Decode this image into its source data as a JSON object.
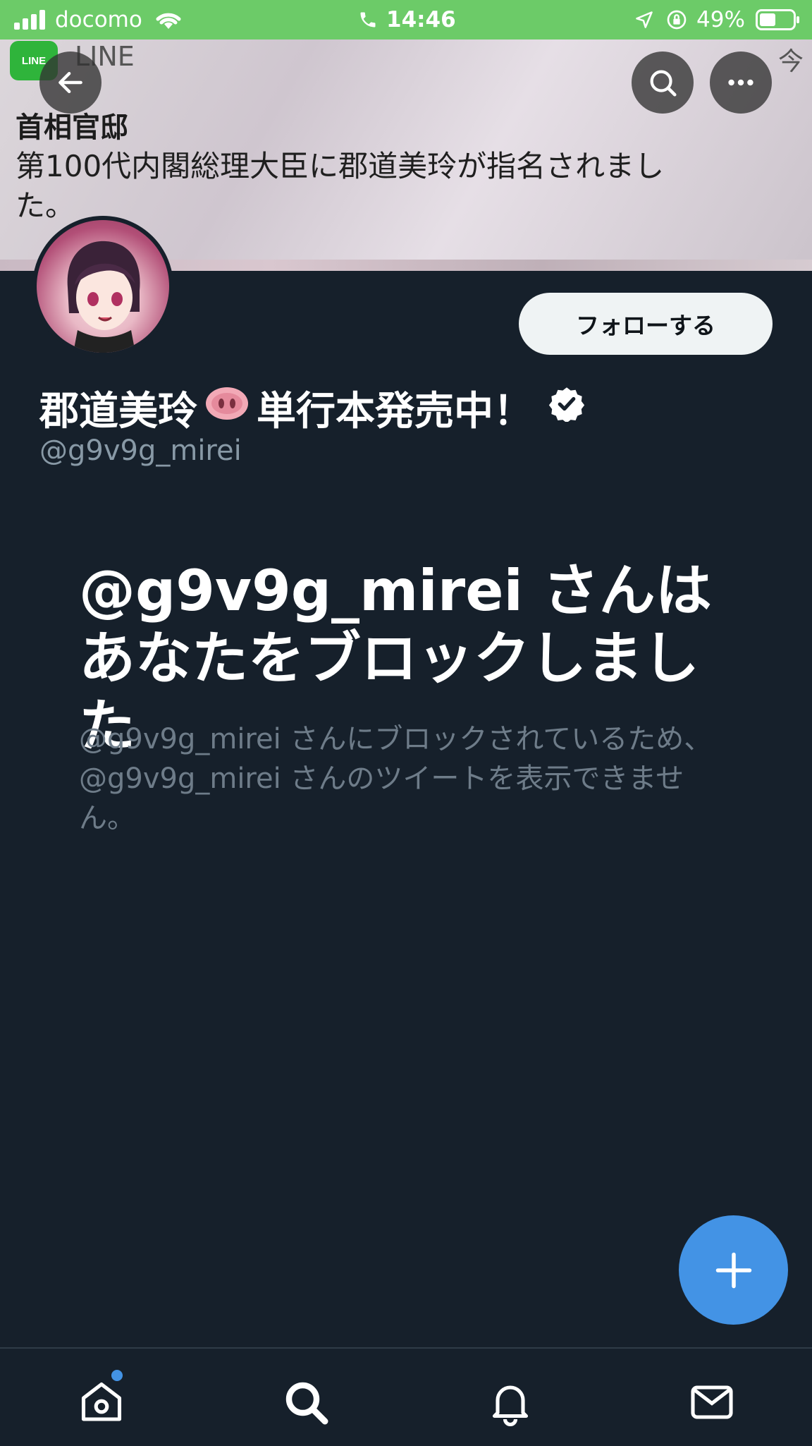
{
  "status_bar": {
    "carrier": "docomo",
    "time": "14:46",
    "battery": "49%",
    "background_color": "#6ccb68"
  },
  "notification": {
    "app_name": "LINE",
    "app_icon_text": "LINE",
    "time": "今",
    "title": "首相官邸",
    "body": "第100代内閣総理大臣に郡道美玲が指名されました。"
  },
  "header": {
    "back_icon": "arrow-left-icon",
    "search_icon": "search-icon",
    "more_icon": "more-horizontal-icon"
  },
  "profile": {
    "display_name": "郡道美玲",
    "display_name_suffix": "単行本発売中！",
    "emoji": "pig-nose",
    "verified": true,
    "handle": "@g9v9g_mirei",
    "follow_button": "フォローする"
  },
  "blocked": {
    "title": "@g9v9g_mirei さんはあなたをブロックしました",
    "description": "@g9v9g_mirei さんにブロックされているため、@g9v9g_mirei さんのツイートを表示できません。"
  },
  "fab": {
    "icon": "plus-icon",
    "color": "#4393e5"
  },
  "tab_bar": {
    "items": [
      {
        "name": "home",
        "icon": "home-icon",
        "badge": true
      },
      {
        "name": "search",
        "icon": "search-icon"
      },
      {
        "name": "notifications",
        "icon": "bell-icon"
      },
      {
        "name": "messages",
        "icon": "mail-icon"
      }
    ]
  },
  "colors": {
    "background": "#16202b",
    "secondary_text": "#8899a6",
    "accent": "#4393e5"
  }
}
